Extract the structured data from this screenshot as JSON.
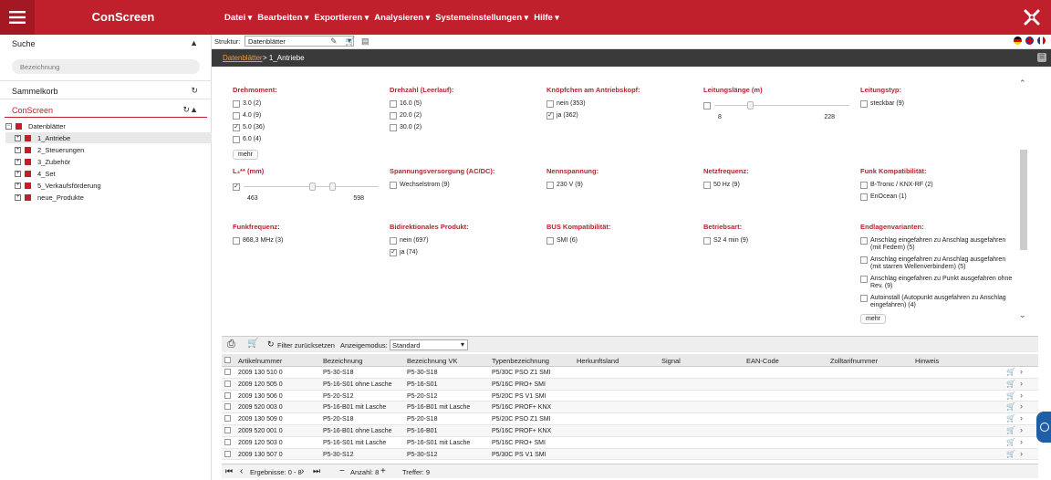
{
  "app": {
    "brand": "ConScreen"
  },
  "menu": [
    "Datei",
    "Bearbeiten",
    "Exportieren",
    "Analysieren",
    "Systemeinstellungen",
    "Hilfe"
  ],
  "sidebar": {
    "search_title": "Suche",
    "search_placeholder": "Bezeichnung",
    "basket_title": "Sammelkorb",
    "conscreen_title": "ConScreen",
    "tree_root": "Datenblätter",
    "tree_items": [
      "1_Antriebe",
      "2_Steuerungen",
      "3_Zubehör",
      "4_Set",
      "5_Verkaufsförderung",
      "neue_Produkte"
    ]
  },
  "toolbar": {
    "struktur_label": "Struktur:",
    "struktur_value": "Datenblätter"
  },
  "breadcrumb": {
    "link": "Datenblätter",
    "current": "> 1_Antriebe"
  },
  "filters": {
    "drehmoment": {
      "title": "Drehmoment:",
      "options": [
        {
          "label": "3.0 (2)",
          "checked": false
        },
        {
          "label": "4.0 (9)",
          "checked": false
        },
        {
          "label": "5.0 (36)",
          "checked": true
        },
        {
          "label": "6.0 (4)",
          "checked": false
        }
      ],
      "more": "mehr"
    },
    "drehzahl": {
      "title": "Drehzahl (Leerlauf):",
      "options": [
        {
          "label": "16.0 (5)",
          "checked": false
        },
        {
          "label": "20.0 (2)",
          "checked": false
        },
        {
          "label": "30.0 (2)",
          "checked": false
        }
      ]
    },
    "knoepfchen": {
      "title": "Knöpfchen am Antriebskopf:",
      "options": [
        {
          "label": "nein (353)",
          "checked": false
        },
        {
          "label": "ja (362)",
          "checked": true
        }
      ]
    },
    "leitungslaenge": {
      "title": "Leitungslänge (m)",
      "min": "8",
      "max": "228"
    },
    "leitungstyp": {
      "title": "Leitungstyp:",
      "options": [
        {
          "label": "steckbar (9)",
          "checked": false
        }
      ]
    },
    "l3": {
      "title": "L₃** (mm)",
      "min": "463",
      "max": "598"
    },
    "spannung": {
      "title": "Spannungsversorgung (AC/DC):",
      "options": [
        {
          "label": "Wechselstrom (9)",
          "checked": false
        }
      ]
    },
    "nennspannung": {
      "title": "Nennspannung:",
      "options": [
        {
          "label": "230 V (9)",
          "checked": false
        }
      ]
    },
    "netzfrequenz": {
      "title": "Netzfrequenz:",
      "options": [
        {
          "label": "50 Hz (9)",
          "checked": false
        }
      ]
    },
    "funk": {
      "title": "Funk Kompatibilität:",
      "options": [
        {
          "label": "B-Tronic / KNX-RF (2)",
          "checked": false
        },
        {
          "label": "EnOcean (1)",
          "checked": false
        }
      ]
    },
    "funkfrequenz": {
      "title": "Funkfrequenz:",
      "options": [
        {
          "label": "868,3 MHz (3)",
          "checked": false
        }
      ]
    },
    "bidirektional": {
      "title": "Bidirektionales Produkt:",
      "options": [
        {
          "label": "nein (697)",
          "checked": false
        },
        {
          "label": "ja (74)",
          "checked": true
        }
      ]
    },
    "bus": {
      "title": "BUS Kompatibilität:",
      "options": [
        {
          "label": "SMI (6)",
          "checked": false
        }
      ]
    },
    "betriebsart": {
      "title": "Betriebsart:",
      "options": [
        {
          "label": "S2 4 min (9)",
          "checked": false
        }
      ]
    },
    "endlage": {
      "title": "Endlagenvarianten:",
      "options": [
        {
          "label": "Anschlag eingefahren zu Anschlag ausgefahren (mit Federn) (5)",
          "checked": false
        },
        {
          "label": "Anschlag eingefahren zu Anschlag ausgefahren (mit starren Wellenverbindern) (5)",
          "checked": false
        },
        {
          "label": "Anschlag eingefahren zu Punkt ausgefahren ohne Rev. (9)",
          "checked": false
        },
        {
          "label": "Autoinstall (Autopunkt ausgefahren zu Anschlag eingefahren) (4)",
          "checked": false
        }
      ],
      "more": "mehr"
    }
  },
  "table_toolbar": {
    "reset": "Filter zurücksetzen",
    "mode_label": "Anzeigemodus:",
    "mode_value": "Standard"
  },
  "table": {
    "columns": [
      "Artikelnummer",
      "Bezeichnung",
      "Bezeichnung VK",
      "Typenbezeichnung",
      "Herkunftsland",
      "Signal",
      "EAN-Code",
      "Zolltarifnummer",
      "Hinweis"
    ],
    "rows": [
      [
        "2009 130 510 0",
        "P5-30-S18",
        "P5-30-S18",
        "P5/30C PSO Z1 SMI"
      ],
      [
        "2009 120 505 0",
        "P5-16-S01 ohne Lasche",
        "P5-16-S01",
        "P5/16C PRO+ SMI"
      ],
      [
        "2009 130 506 0",
        "P5-20-S12",
        "P5-20-S12",
        "P5/20C PS V1 SMI"
      ],
      [
        "2009 520 003 0",
        "P5-16-B01 mit Lasche",
        "P5-16-B01 mit Lasche",
        "P5/16C PROF+ KNX"
      ],
      [
        "2009 130 509 0",
        "P5-20-S18",
        "P5-20-S18",
        "P5/20C PSO Z1 SMI"
      ],
      [
        "2009 520 001 0",
        "P5-16-B01 ohne Lasche",
        "P5-16-B01",
        "P5/16C PROF+ KNX"
      ],
      [
        "2009 120 503 0",
        "P5-16-S01 mit Lasche",
        "P5-16-S01 mit Lasche",
        "P5/16C PRO+ SMI"
      ],
      [
        "2009 130 507 0",
        "P5-30-S12",
        "P5-30-S12",
        "P5/30C PS V1 SMI"
      ]
    ]
  },
  "footer": {
    "results": "Ergebnisse: 0 - 8",
    "count": "Anzahl: 8",
    "hits": "Treffer: 9"
  }
}
